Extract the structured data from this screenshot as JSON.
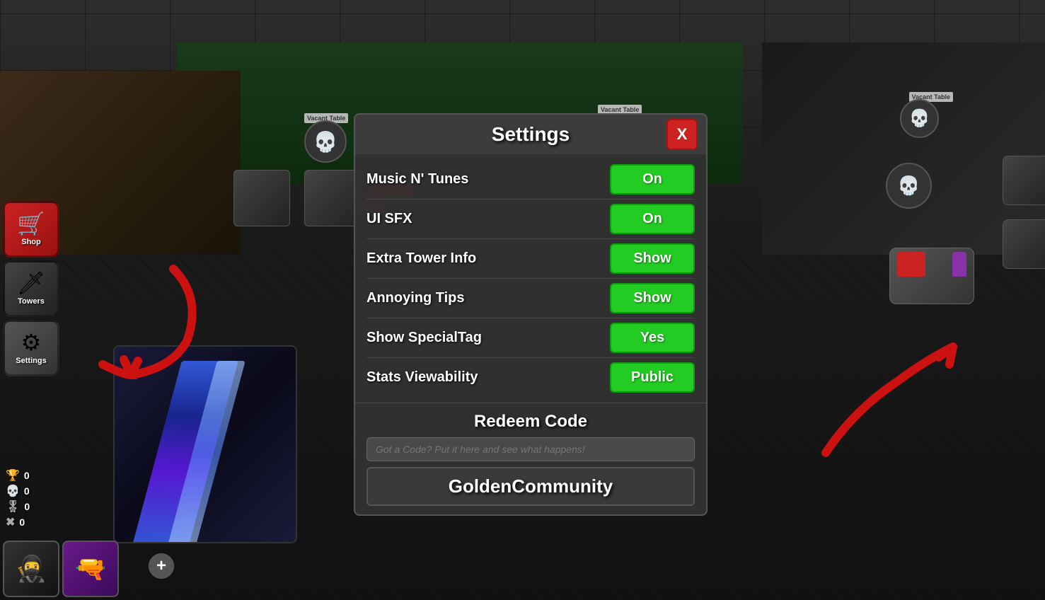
{
  "game": {
    "title": "Settings",
    "background": "dark game room"
  },
  "sidebar": {
    "items": [
      {
        "id": "shop",
        "label": "Shop",
        "icon": "🛒"
      },
      {
        "id": "towers",
        "label": "Towers",
        "icon": "🗡"
      },
      {
        "id": "settings",
        "label": "Settings",
        "icon": "⚙"
      }
    ]
  },
  "stats": [
    {
      "icon": "🏆",
      "type": "gold",
      "value": "0"
    },
    {
      "icon": "💀",
      "type": "skull",
      "value": "0"
    },
    {
      "icon": "🎖",
      "type": "rank",
      "value": "0"
    },
    {
      "icon": "✖",
      "type": "cross",
      "value": "0"
    }
  ],
  "modal": {
    "title": "Settings",
    "close_label": "X",
    "settings": [
      {
        "label": "Music N' Tunes",
        "value": "On",
        "id": "music"
      },
      {
        "label": "UI SFX",
        "value": "On",
        "id": "ui-sfx"
      },
      {
        "label": "Extra Tower Info",
        "value": "Show",
        "id": "tower-info"
      },
      {
        "label": "Annoying Tips",
        "value": "Show",
        "id": "tips"
      },
      {
        "label": "Show SpecialTag",
        "value": "Yes",
        "id": "special-tag"
      },
      {
        "label": "Stats Viewability",
        "value": "Public",
        "id": "stats-view"
      }
    ],
    "redeem": {
      "title": "Redeem Code",
      "placeholder": "Got a Code? Put it here and see what happens!",
      "code_value": "GoldenCommunity"
    }
  },
  "vacant_tables": [
    {
      "label": "Vacant Table"
    },
    {
      "label": "Vacant Table"
    },
    {
      "label": "Vacant Table"
    }
  ]
}
